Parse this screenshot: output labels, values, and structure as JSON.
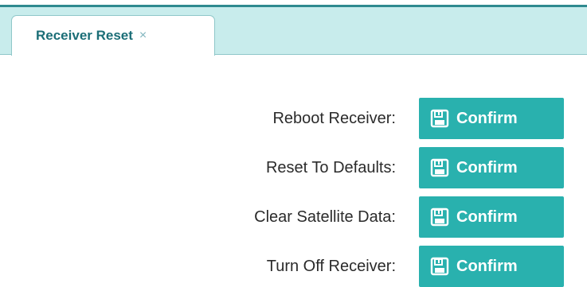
{
  "tab": {
    "title": "Receiver Reset",
    "close_label": "×"
  },
  "actions": [
    {
      "label": "Reboot Receiver:",
      "button": "Confirm",
      "icon": "save-icon"
    },
    {
      "label": "Reset To Defaults:",
      "button": "Confirm",
      "icon": "save-icon"
    },
    {
      "label": "Clear Satellite Data:",
      "button": "Confirm",
      "icon": "save-icon"
    },
    {
      "label": "Turn Off Receiver:",
      "button": "Confirm",
      "icon": "save-icon"
    }
  ],
  "colors": {
    "accent": "#29b1ae",
    "tab_strip": "#c8ecec",
    "tab_text": "#1b6e77"
  }
}
